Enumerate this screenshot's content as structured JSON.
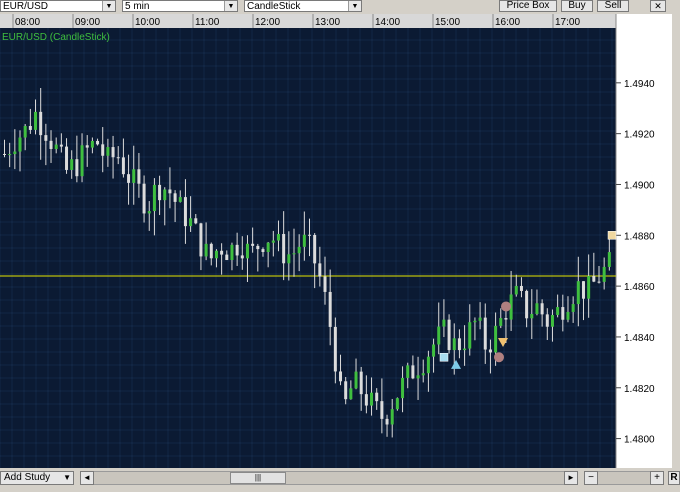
{
  "toolbar": {
    "symbol": "EUR/USD",
    "interval": "5 min",
    "chart_style": "CandleStick",
    "price_box_label": "Price Box",
    "buy_label": "Buy",
    "sell_label": "Sell",
    "dropdown_glyph": "▼"
  },
  "chart": {
    "legend_label": "EUR/USD (CandleStick)",
    "time_labels": [
      "08:00",
      "09:00",
      "10:00",
      "11:00",
      "12:00",
      "13:00",
      "14:00",
      "15:00",
      "16:00",
      "17:00"
    ],
    "price_labels": [
      "1.4940",
      "1.4920",
      "1.4900",
      "1.4880",
      "1.4860",
      "1.4840",
      "1.4820",
      "1.4800"
    ],
    "colors": {
      "background": "#0b1a33",
      "grid": "#2a4e78",
      "up_candle": "#3fbf3f",
      "down_candle": "#dcdcdc",
      "reference_line": "#e6e600",
      "axis_bg": "#ffffff"
    }
  },
  "chart_data": {
    "type": "candlestick",
    "title": "EUR/USD (CandleStick)",
    "interval": "5 min",
    "reference_line_price": 1.4864,
    "ylim": [
      1.479,
      1.496
    ],
    "x_ticks": [
      "08:00",
      "09:00",
      "10:00",
      "11:00",
      "12:00",
      "13:00",
      "14:00",
      "15:00",
      "16:00",
      "17:00"
    ],
    "y_ticks": [
      1.494,
      1.492,
      1.49,
      1.488,
      1.486,
      1.484,
      1.482,
      1.48
    ],
    "price_path": [
      1.4912,
      1.4918,
      1.4921,
      1.4928,
      1.4922,
      1.4914,
      1.4905,
      1.4908,
      1.4913,
      1.4917,
      1.4909,
      1.4912,
      1.4904,
      1.4898,
      1.4892,
      1.49,
      1.4898,
      1.4891,
      1.4886,
      1.4878,
      1.487,
      1.4876,
      1.4874,
      1.4878,
      1.4872,
      1.4878,
      1.488,
      1.4874,
      1.4872,
      1.4878,
      1.4873,
      1.486,
      1.484,
      1.481,
      1.4822,
      1.4818,
      1.4812,
      1.4808,
      1.4816,
      1.4822,
      1.4828,
      1.4832,
      1.4838,
      1.4842,
      1.4836,
      1.484,
      1.4846,
      1.4836,
      1.4842,
      1.4852,
      1.4856,
      1.485,
      1.4852,
      1.4846,
      1.485,
      1.4856,
      1.486,
      1.4858,
      1.4864,
      1.4868
    ],
    "markers": [
      {
        "shape": "square",
        "price": 1.4832,
        "color": "#a8dcf0"
      },
      {
        "shape": "triangle-up",
        "price": 1.4829,
        "color": "#7ecbe8"
      },
      {
        "shape": "circle",
        "price": 1.4852,
        "color": "#b08080"
      },
      {
        "shape": "triangle-down",
        "price": 1.4838,
        "color": "#f0c070"
      },
      {
        "shape": "circle",
        "price": 1.4832,
        "color": "#b08080"
      },
      {
        "shape": "square",
        "price": 1.488,
        "color": "#f0d8a0"
      }
    ]
  },
  "bottom": {
    "add_study_label": "Add Study",
    "dropdown_glyph": "▼",
    "scroll_left_glyph": "◄",
    "scroll_right_glyph": "►",
    "zoom_out_glyph": "−",
    "zoom_in_glyph": "+",
    "grip_glyph": "|||",
    "reset_label": "R"
  }
}
